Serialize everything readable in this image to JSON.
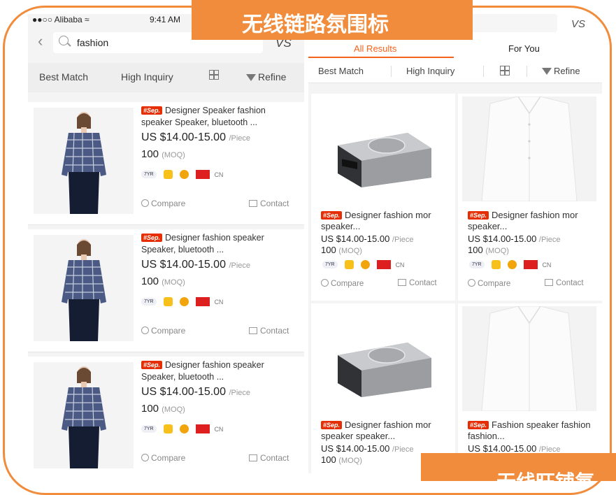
{
  "banner": {
    "top_text": "无线链路氛围标",
    "bottom_text": "无线旺铺氛"
  },
  "left": {
    "status": {
      "carrier": "●●○○ Alibaba ≈",
      "time": "9:41 AM"
    },
    "search": {
      "query": "fashion",
      "back_glyph": "‹",
      "vs": "VS"
    },
    "filter": {
      "best_match": "Best Match",
      "high_inquiry": "High Inquiry",
      "refine": "Refine"
    },
    "items": [
      {
        "tag": "#Sep.",
        "title": "Designer Speaker fashion speaker Speaker, bluetooth ...",
        "price": "US $14.00-15.00",
        "unit": "/Piece",
        "moq": "100",
        "moq_label": "(MOQ)",
        "yr": "7YR",
        "country": "CN",
        "compare": "Compare",
        "contact": "Contact"
      },
      {
        "tag": "#Sep.",
        "title": "Designer fashion speaker Speaker, bluetooth ...",
        "price": "US $14.00-15.00",
        "unit": "/Piece",
        "moq": "100",
        "moq_label": "(MOQ)",
        "yr": "7YR",
        "country": "CN",
        "compare": "Compare",
        "contact": "Contact"
      },
      {
        "tag": "#Sep.",
        "title": "Designer fashion speaker Speaker, bluetooth ...",
        "price": "US $14.00-15.00",
        "unit": "/Piece",
        "moq": "100",
        "moq_label": "(MOQ)",
        "yr": "7YR",
        "country": "CN",
        "compare": "Compare",
        "contact": "Contact"
      }
    ]
  },
  "right": {
    "vs": "VS",
    "tabs": {
      "all": "All Results",
      "for_you": "For You"
    },
    "filter": {
      "best_match": "Best Match",
      "high_inquiry": "High Inquiry",
      "refine": "Refine"
    },
    "items": [
      {
        "tag": "#Sep.",
        "title": "Designer fashion mor speaker...",
        "price": "US $14.00-15.00",
        "unit": "/Piece",
        "moq": "100",
        "moq_label": "(MOQ)",
        "yr": "7YR",
        "country": "CN",
        "compare": "Compare",
        "contact": "Contact"
      },
      {
        "tag": "#Sep.",
        "title": "Designer fashion mor speaker...",
        "price": "US $14.00-15.00",
        "unit": "/Piece",
        "moq": "100",
        "moq_label": "(MOQ)",
        "yr": "7YR",
        "country": "CN",
        "compare": "Compare",
        "contact": "Contact"
      },
      {
        "tag": "#Sep.",
        "title": "Designer fashion mor speaker speaker...",
        "price": "US $14.00-15.00",
        "unit": "/Piece",
        "moq": "100",
        "moq_label": "(MOQ)"
      },
      {
        "tag": "#Sep.",
        "title": "Fashion speaker fashion fashion...",
        "price": "US $14.00-15.00",
        "unit": "/Piece"
      }
    ]
  },
  "colors": {
    "accent": "#f08c3c",
    "tab_active": "#f7631b",
    "tag_red": "#e62e04"
  }
}
